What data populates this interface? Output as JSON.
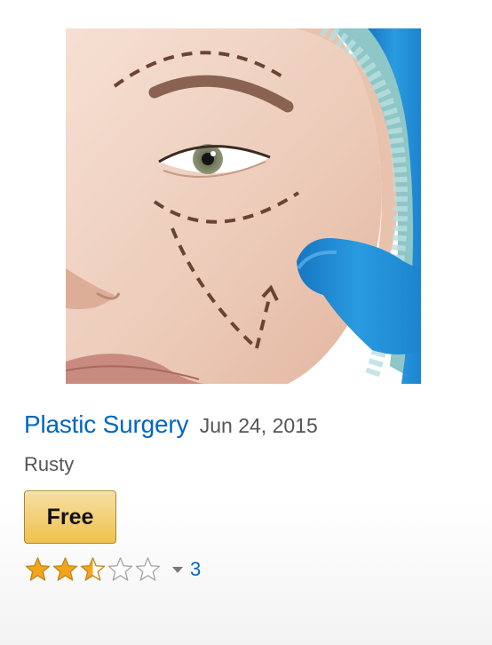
{
  "product": {
    "image_subject": "plastic-surgery-face-markings",
    "title": "Plastic Surgery",
    "date": "Jun 24, 2015",
    "author": "Rusty",
    "price_label": "Free",
    "rating": {
      "stars": 2.5,
      "max_stars": 5,
      "review_count": "3"
    }
  },
  "colors": {
    "link": "#0066c0",
    "button": "#f0c14b",
    "star_fill": "#f4a41d",
    "star_outline": "#c28a1a",
    "glove": "#1f8fd6"
  },
  "icons": {
    "rating_stars": "star-icon",
    "dropdown": "caret-down-icon"
  }
}
